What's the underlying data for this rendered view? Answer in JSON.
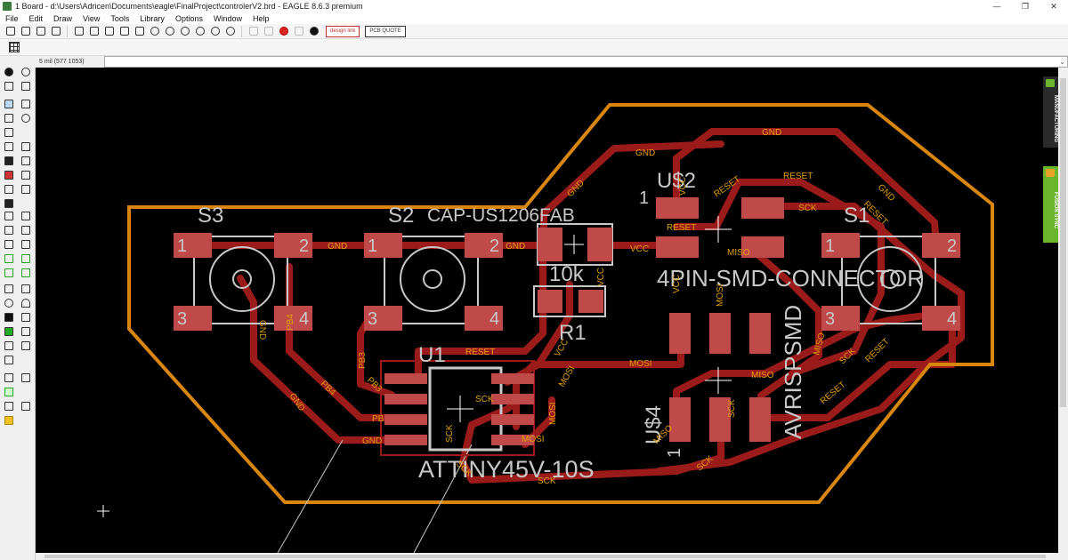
{
  "window": {
    "title": "1 Board - d:\\Users\\Adricen\\Documents\\eagle\\FinalProject\\controlerV2.brd - EAGLE 8.6.3 premium",
    "minimize": "—",
    "maximize": "❐",
    "close": "✕"
  },
  "menu": [
    "File",
    "Edit",
    "Draw",
    "View",
    "Tools",
    "Library",
    "Options",
    "Window",
    "Help"
  ],
  "toolbar": {
    "design_link": "design link",
    "pcb_quote": "PCB QUOTE"
  },
  "status": {
    "coordinate": "5 mil (577 1053)"
  },
  "side_tabs": {
    "manufacturing": "MANUFACTURING",
    "fusion_sync": "FUSION SYNC"
  },
  "board": {
    "components": {
      "s3": "S3",
      "s2": "S2",
      "s1": "S1",
      "c1_value": "CAP-US1206FAB",
      "c1_name": "10k",
      "r1": "R1",
      "u1": "U1",
      "u1_value": "ATTINY45V-10S",
      "us2": "U$2",
      "us2_value": "4PIN-SMD-CONNECTOR",
      "us4": "U$4",
      "us4_value": "AVRISPSMD",
      "pin1_a": "1",
      "pin1_b": "1"
    },
    "pads": {
      "p1": "1",
      "p2": "2",
      "p3": "3",
      "p4": "4"
    },
    "nets": {
      "gnd": "GND",
      "vcc": "VCC",
      "reset": "RESET",
      "sck": "SCK",
      "mosi": "MOSI",
      "miso": "MISO",
      "pb3": "PB3",
      "pb4": "PB4",
      "pb": "PB"
    },
    "colors": {
      "copper": "#9b1b1b",
      "outline": "#d9860f",
      "pad": "#c04a4a",
      "label": "#e0a000",
      "silk": "#c8c8c8"
    }
  }
}
